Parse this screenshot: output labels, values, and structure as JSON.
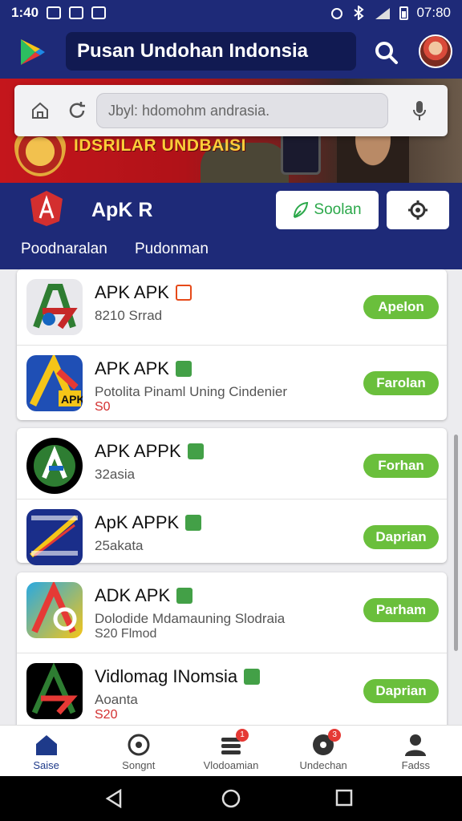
{
  "status_bar": {
    "time": "1:40",
    "clock_right": "07:80"
  },
  "app_bar": {
    "title": "Pusan Undohan Indonsia"
  },
  "banner": {
    "text": "IDSRILAR UNDBAISI",
    "browser": {
      "input_placeholder": "Jbyl: hdomohm andrasia."
    }
  },
  "store": {
    "name": "ApK R",
    "search_button": "Soolan",
    "tabs": [
      "Poodnaralan",
      "Pudonman"
    ]
  },
  "apps": [
    {
      "name": "APK APK",
      "sub": "8210 Srrad",
      "sub2": "",
      "button": "Apelon"
    },
    {
      "name": "APK APK",
      "sub": "Potolita Pinaml Uning Cindenier",
      "sub2": "S0",
      "button": "Farolan"
    },
    {
      "name": "APK APPK",
      "sub": "32asia",
      "sub2": "",
      "button": "Forhan"
    },
    {
      "name": "ApK APPK",
      "sub": "25akata",
      "sub2": "",
      "button": "Daprian"
    },
    {
      "name": "ADK APK",
      "sub": "Dolodide Mdamauning Slodraia",
      "sub2_plain": "S20 Flmod",
      "button": "Parham"
    },
    {
      "name": "Vidlomag INomsia",
      "sub": "Aoanta",
      "sub2": "S20",
      "button": "Daprian"
    }
  ],
  "bottom_nav": [
    {
      "label": "Saise",
      "icon": "home-icon",
      "badge": ""
    },
    {
      "label": "Songnt",
      "icon": "compass-icon",
      "badge": ""
    },
    {
      "label": "Vlodoamian",
      "icon": "list-icon",
      "badge": "1"
    },
    {
      "label": "Undechan",
      "icon": "download-icon",
      "badge": "3"
    },
    {
      "label": "Fadss",
      "icon": "person-icon",
      "badge": ""
    }
  ],
  "colors": {
    "primary": "#1e2a78",
    "accent_green": "#6abf3c",
    "banner_red": "#c4161c"
  }
}
